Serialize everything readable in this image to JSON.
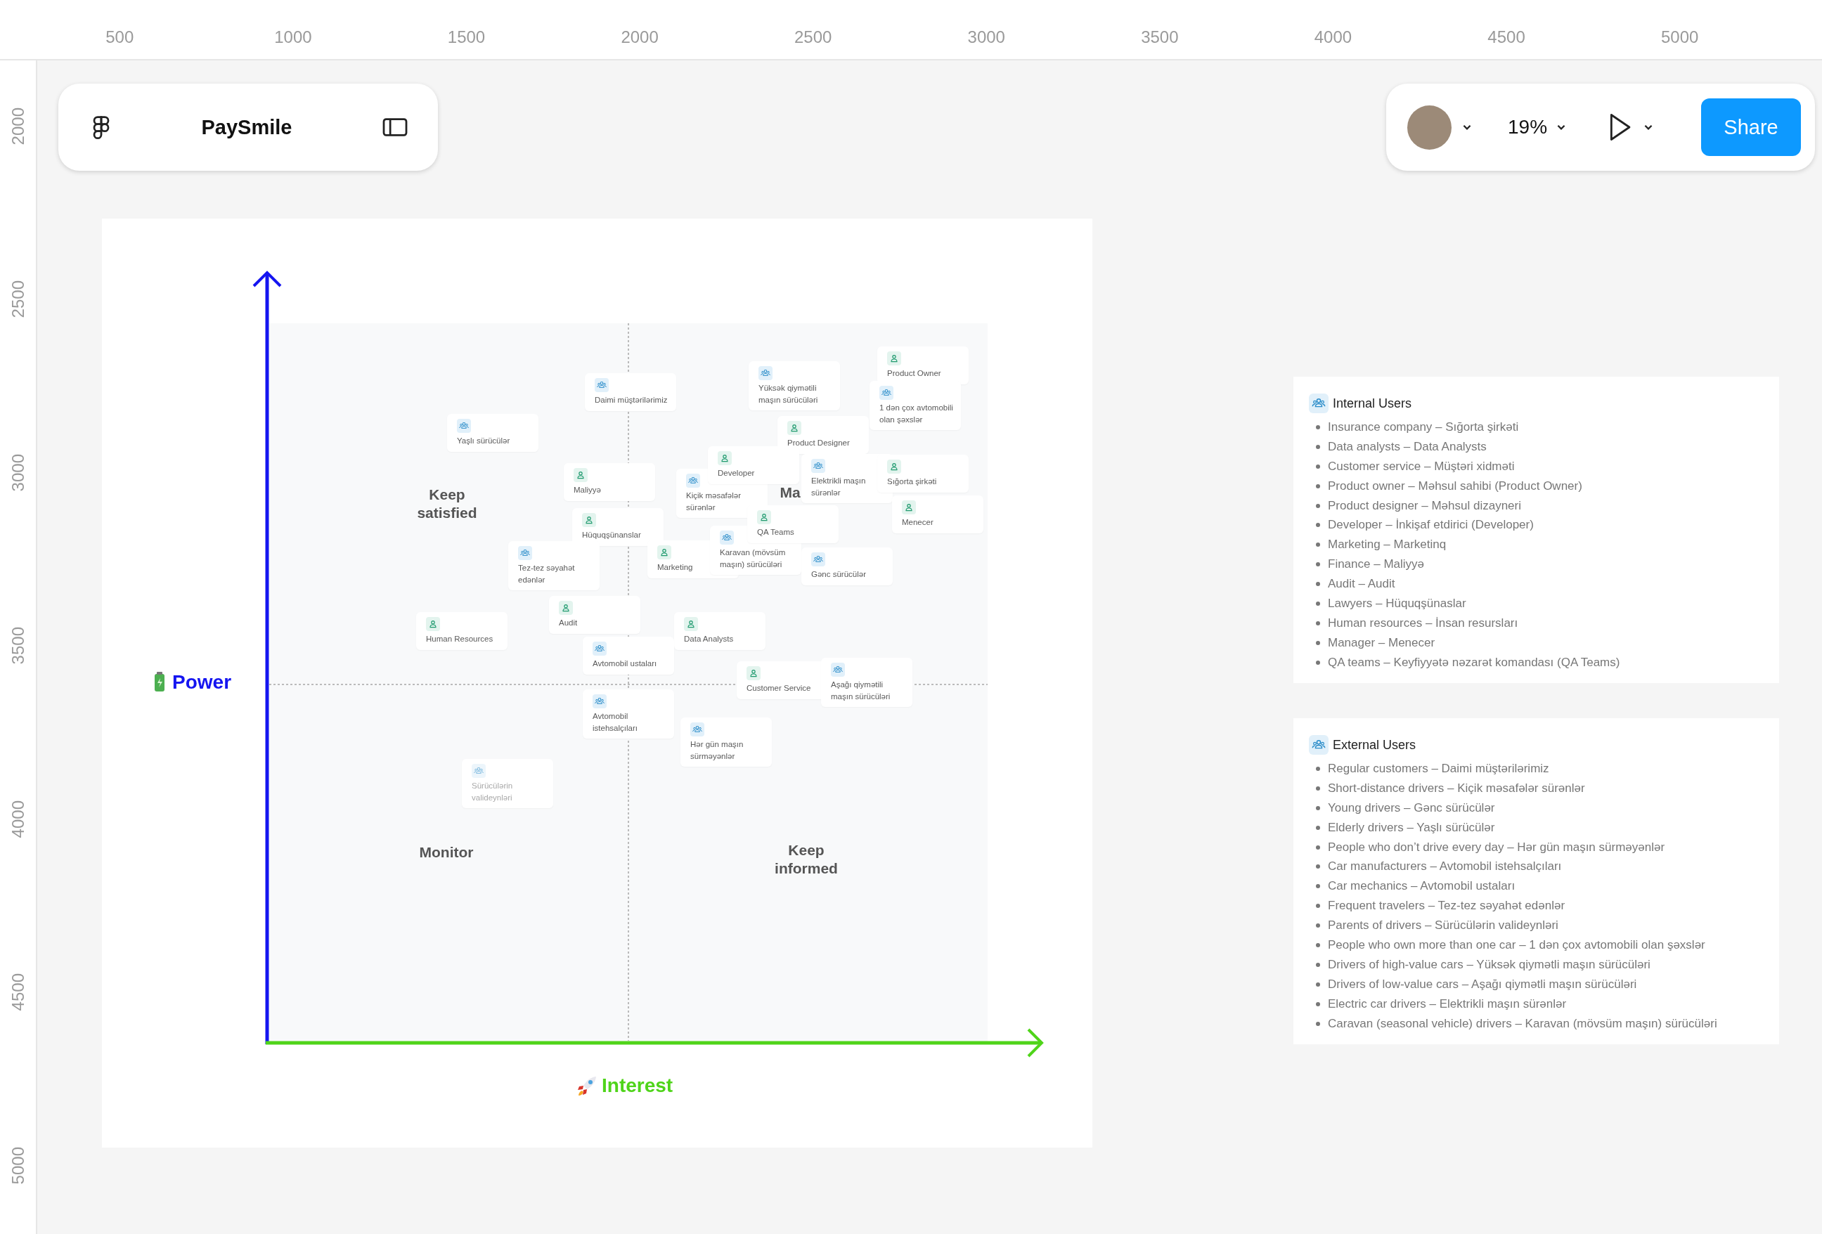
{
  "rulers": {
    "horizontal": [
      "500",
      "1000",
      "1500",
      "2000",
      "2500",
      "3000",
      "3500",
      "4000",
      "4500",
      "5000"
    ],
    "vertical": [
      "2000",
      "2500",
      "3000",
      "3500",
      "4000",
      "4500",
      "5000"
    ]
  },
  "file_bar": {
    "title": "PaySmile"
  },
  "view_bar": {
    "zoom": "19%",
    "share_button": "Share"
  },
  "matrix": {
    "y_axis_label": "Power",
    "x_axis_label": "Interest",
    "quadrant_labels": [
      "Keep satisfied",
      "Ma",
      "Monitor",
      "Keep informed"
    ],
    "stakeholders": [
      {
        "label": "Yaşlı sürücülər",
        "kind": "group",
        "dimmed": false
      },
      {
        "label": "Daimi müştərilərimiz",
        "kind": "group",
        "dimmed": false
      },
      {
        "label": "Yüksək qiymətili maşın sürücüləri",
        "kind": "group",
        "dimmed": false
      },
      {
        "label": "Product Owner",
        "kind": "person",
        "dimmed": false
      },
      {
        "label": "1 dən çox avtomobili olan şəxslər",
        "kind": "group",
        "dimmed": false
      },
      {
        "label": "Product Designer",
        "kind": "person",
        "dimmed": false
      },
      {
        "label": "Developer",
        "kind": "person",
        "dimmed": false
      },
      {
        "label": "Kiçik məsafələr sürənlər",
        "kind": "group",
        "dimmed": false
      },
      {
        "label": "Elektrikli maşın sürənlər",
        "kind": "group",
        "dimmed": false
      },
      {
        "label": "Sığorta şirkəti",
        "kind": "person",
        "dimmed": false
      },
      {
        "label": "Menecer",
        "kind": "person",
        "dimmed": false
      },
      {
        "label": "Maliyyə",
        "kind": "person",
        "dimmed": false
      },
      {
        "label": "Hüquqşünanslar",
        "kind": "person",
        "dimmed": false
      },
      {
        "label": "QA Teams",
        "kind": "person",
        "dimmed": false
      },
      {
        "label": "Karavan (mövsüm maşın) sürücüləri",
        "kind": "group",
        "dimmed": false
      },
      {
        "label": "Tez-tez səyahət edənlər",
        "kind": "group",
        "dimmed": false
      },
      {
        "label": "Marketing",
        "kind": "person",
        "dimmed": false
      },
      {
        "label": "Gənc sürücülər",
        "kind": "group",
        "dimmed": false
      },
      {
        "label": "Human Resources",
        "kind": "person",
        "dimmed": false
      },
      {
        "label": "Audit",
        "kind": "person",
        "dimmed": false
      },
      {
        "label": "Data Analysts",
        "kind": "person",
        "dimmed": false
      },
      {
        "label": "Avtomobil ustaları",
        "kind": "group",
        "dimmed": false
      },
      {
        "label": "Customer Service",
        "kind": "person",
        "dimmed": false
      },
      {
        "label": "Aşağı qiymətili maşın sürücüləri",
        "kind": "group",
        "dimmed": false
      },
      {
        "label": "Avtomobil istehsalçıları",
        "kind": "group",
        "dimmed": false
      },
      {
        "label": "Hər gün maşın sürməyənlər",
        "kind": "group",
        "dimmed": false
      },
      {
        "label": "Sürücülərin valideynləri",
        "kind": "group",
        "dimmed": true
      }
    ]
  },
  "lists": [
    {
      "title": "Internal Users",
      "items": [
        "Insurance company – Sığorta şirkəti",
        "Data analysts – Data Analysts",
        "Customer service – Müştəri xidməti",
        "Product owner – Məhsul sahibi (Product Owner)",
        "Product designer – Məhsul dizayneri",
        "Developer – İnkişaf etdirici (Developer)",
        "Marketing – Marketinq",
        "Finance – Maliyyə",
        "Audit – Audit",
        "Lawyers – Hüquqşünaslar",
        "Human resources – İnsan resursları",
        "Manager – Menecer",
        "QA teams – Keyfiyyətə nəzarət komandası (QA Teams)"
      ]
    },
    {
      "title": "External Users",
      "items": [
        "Regular customers – Daimi müştərilərimiz",
        "Short-distance drivers – Kiçik məsafələr sürənlər",
        "Young drivers – Gənc sürücülər",
        "Elderly drivers – Yaşlı sürücülər",
        "People who don’t drive every day – Hər gün maşın sürməyənlər",
        "Car manufacturers – Avtomobil istehsalçıları",
        "Car mechanics – Avtomobil ustaları",
        "Frequent travelers – Tez-tez səyahət edənlər",
        "Parents of drivers – Sürücülərin valideynləri",
        "People who own more than one car – 1 dən çox avtomobili olan şəxslər",
        "Drivers of high-value cars – Yüksək qiymətli maşın sürücüləri",
        "Drivers of low-value cars – Aşağı qiymətli maşın sürücüləri",
        "Electric car drivers – Elektrikli maşın sürənlər",
        "Caravan (seasonal vehicle) drivers – Karavan (mövsüm maşın) sürücüləri"
      ]
    }
  ]
}
